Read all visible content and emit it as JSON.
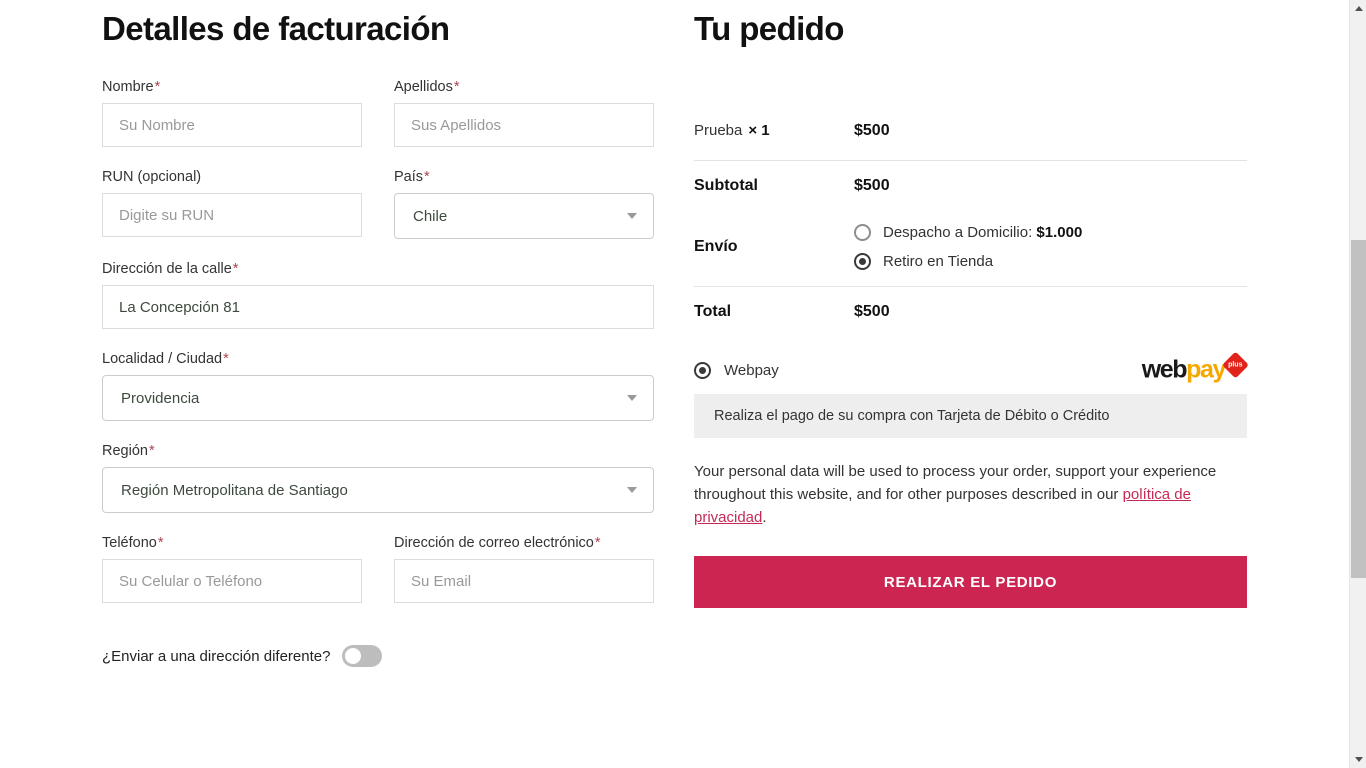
{
  "billing": {
    "title": "Detalles de facturación",
    "fields": {
      "first_name": {
        "label": "Nombre",
        "required": "*",
        "placeholder": "Su Nombre",
        "value": ""
      },
      "last_name": {
        "label": "Apellidos",
        "required": "*",
        "placeholder": "Sus Apellidos",
        "value": ""
      },
      "run": {
        "label": "RUN (opcional)",
        "required": "",
        "placeholder": "Digite su RUN",
        "value": ""
      },
      "country": {
        "label": "País",
        "required": "*",
        "value": "Chile"
      },
      "street": {
        "label": "Dirección de la calle",
        "required": "*",
        "value": "La Concepción 81"
      },
      "city": {
        "label": "Localidad / Ciudad",
        "required": "*",
        "value": "Providencia"
      },
      "region": {
        "label": "Región",
        "required": "*",
        "value": "Región Metropolitana de Santiago"
      },
      "phone": {
        "label": "Teléfono",
        "required": "*",
        "placeholder": "Su Celular o Teléfono",
        "value": ""
      },
      "email": {
        "label": "Dirección de correo electrónico",
        "required": "*",
        "placeholder": "Su Email",
        "value": ""
      }
    },
    "ship_different_label": "¿Enviar a una dirección diferente?",
    "ship_different_state": "off"
  },
  "order": {
    "title": "Tu pedido",
    "product": {
      "name": "Prueba",
      "qty": "× 1",
      "price": "$500"
    },
    "subtotal": {
      "label": "Subtotal",
      "value": "$500"
    },
    "shipping": {
      "label": "Envío",
      "options": [
        {
          "text": "Despacho a Domicilio: ",
          "price": "$1.000",
          "selected": false
        },
        {
          "text": "Retiro en Tienda",
          "price": "",
          "selected": true
        }
      ]
    },
    "total": {
      "label": "Total",
      "value": "$500"
    },
    "payment": {
      "method_label": "Webpay",
      "method_selected": true,
      "logo": {
        "part1": "web",
        "part2": "pay",
        "badge": "plus"
      },
      "description": "Realiza el pago de su compra con Tarjeta de Débito o Crédito"
    },
    "privacy_text": "Your personal data will be used to process your order, support your experience throughout this website, and for other purposes described in our ",
    "privacy_link": "política de privacidad",
    "privacy_end": ".",
    "place_order_button": "REALIZAR EL PEDIDO"
  },
  "colors": {
    "accent": "#cc2551",
    "link": "#c62a54",
    "required": "#a94552",
    "webpay_orange": "#f5a800",
    "webpay_red": "#e2231a"
  }
}
